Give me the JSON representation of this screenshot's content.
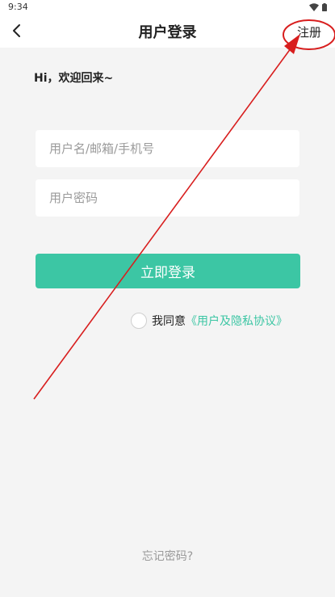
{
  "status_bar": {
    "time": "9:34",
    "icons": [
      "wifi-icon",
      "battery-icon"
    ]
  },
  "nav": {
    "back_icon": "chevron-left-icon",
    "title": "用户登录",
    "register_label": "注册"
  },
  "welcome_text": "Hi，欢迎回来~",
  "form": {
    "username_placeholder": "用户名/邮箱/手机号",
    "username_value": "",
    "password_placeholder": "用户密码",
    "password_value": "",
    "login_label": "立即登录"
  },
  "agreement": {
    "checked": false,
    "prefix": "我同意",
    "link_text": "《用户及隐私协议》"
  },
  "forgot_password": "忘记密码?",
  "colors": {
    "accent": "#3cc6a4",
    "annotation": "#d81e1e",
    "background": "#f4f4f4"
  }
}
